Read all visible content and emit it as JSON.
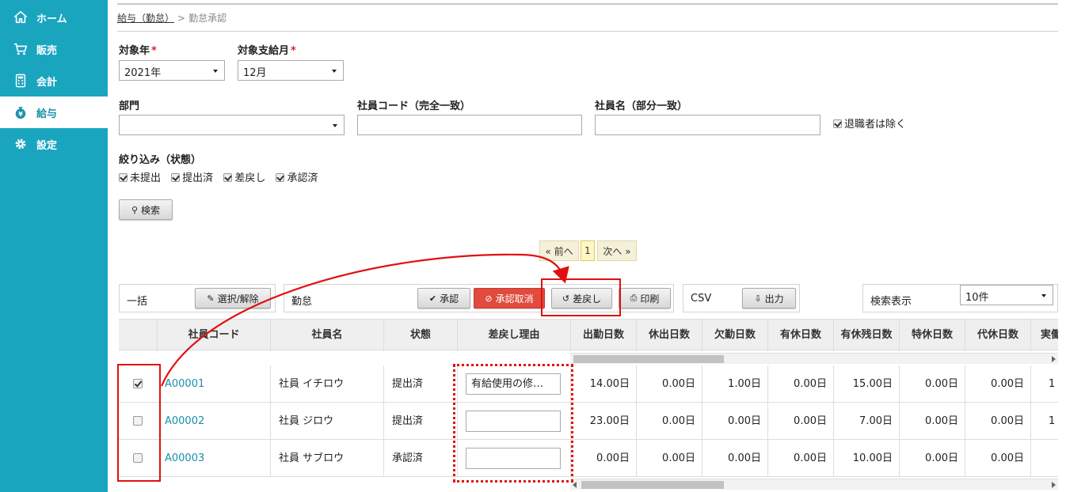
{
  "sidebar": {
    "accent": "#1aa5bf",
    "items": [
      {
        "label": "ホーム",
        "icon": "home-icon"
      },
      {
        "label": "販売",
        "icon": "cart-icon"
      },
      {
        "label": "会計",
        "icon": "calculator-icon"
      },
      {
        "label": "給与",
        "icon": "money-bag-icon",
        "active": true
      },
      {
        "label": "設定",
        "icon": "gear-icon"
      }
    ]
  },
  "breadcrumb": {
    "parent": "給与（勤怠）",
    "separator": ">",
    "current": "勤怠承認"
  },
  "form": {
    "year_label": "対象年",
    "year_value": "2021年",
    "month_label": "対象支給月",
    "month_value": "12月",
    "required_mark": "*",
    "dept_label": "部門",
    "dept_value": "",
    "code_label": "社員コード（完全一致）",
    "name_label": "社員名（部分一致）",
    "exclude_retired_label": "退職者は除く",
    "exclude_retired_checked": true,
    "filter_label": "絞り込み（状態）",
    "filters": [
      {
        "label": "未提出",
        "checked": true
      },
      {
        "label": "提出済",
        "checked": true
      },
      {
        "label": "差戻し",
        "checked": true
      },
      {
        "label": "承認済",
        "checked": true
      }
    ],
    "search_button": "検索"
  },
  "pager": {
    "prev": "« 前へ",
    "current": "1",
    "next": "次へ »"
  },
  "toolbar": {
    "bulk_label": "一括",
    "select_toggle": "選択/解除",
    "attendance_label": "勤怠",
    "approve": "承認",
    "cancel_approval": "承認取消",
    "send_back": "差戻し",
    "print": "印刷",
    "csv_label": "CSV",
    "export": "出力",
    "display_count_label": "検索表示",
    "display_count_value": "10件"
  },
  "table": {
    "headers": [
      "社員コード",
      "社員名",
      "状態",
      "差戻し理由",
      "出勤日数",
      "休出日数",
      "欠勤日数",
      "有休日数",
      "有休残日数",
      "特休日数",
      "代休日数",
      "実働"
    ],
    "rows": [
      {
        "checked": true,
        "code": "A00001",
        "name": "社員 イチロウ",
        "status": "提出済",
        "reason": "有給使用の修…",
        "values": [
          "14.00日",
          "0.00日",
          "1.00日",
          "0.00日",
          "15.00日",
          "0.00日",
          "0.00日",
          "1"
        ]
      },
      {
        "checked": false,
        "code": "A00002",
        "name": "社員 ジロウ",
        "status": "提出済",
        "reason": "",
        "values": [
          "23.00日",
          "0.00日",
          "0.00日",
          "0.00日",
          "7.00日",
          "0.00日",
          "0.00日",
          "1"
        ]
      },
      {
        "checked": false,
        "code": "A00003",
        "name": "社員 サブロウ",
        "status": "承認済",
        "reason": "",
        "values": [
          "0.00日",
          "0.00日",
          "0.00日",
          "0.00日",
          "10.00日",
          "0.00日",
          "0.00日",
          ""
        ]
      }
    ]
  },
  "annotation_color": "#e01010"
}
